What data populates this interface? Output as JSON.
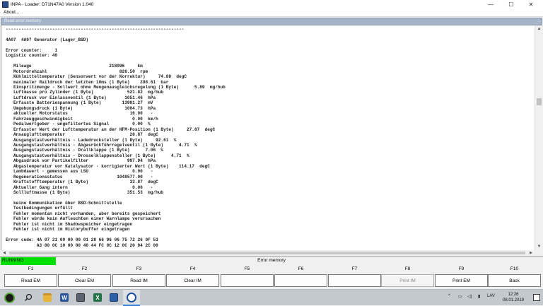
{
  "window": {
    "title": "INPA - Loader:  D71N47A0 Version 1.040",
    "min_glyph": "—",
    "max_glyph": "☐",
    "close_glyph": "✕"
  },
  "menubar": {
    "about": "About..."
  },
  "panel": {
    "header": "Read error memory",
    "text_lines": [
      "---------------------------------------------------------------------",
      "",
      "4A07  4A07 Generator (Lager_BSD)",
      "",
      "Error counter:     1",
      "Logistic counter: 40",
      "",
      "   Mileage                              218096     km",
      "   Motordrehzahl                            826.50  rpm",
      "   Kühlmitteltemperatur (Sensorwert vor der Korrektur)     74.88  degC",
      "   maximaler Raildruck der letzten 10ms (1 Byte)    298.61  bar",
      "   Einspritzmenge - Sollwert ohne Mengenausgleichsregelung (1 Byte)      5.89  mg/hub",
      "   Luftmasse pro Zylinder (1 Byte)             521.82  mg/hub",
      "   Luftdruck vor Einlassventil (1 Byte)       1051.46  hPa",
      "   Erfasste Batteriespannung (1 Byte)        13901.27  mV",
      "   Umgebungsdruck (1 Byte)                    1004.73  hPa",
      "   aktueller Motorstatus                        16.00   -",
      "   Fahrzeuggeschwindigkeit                       0.00  km/h",
      "   Pedalwertgeber - ungefiltertes Signal         0.00  %",
      "   Erfasster Wert der Lufttemperatur an der HFM-Position (1 Byte)     27.87  degC",
      "   Ansauglufttemperatur                         28.87  degC",
      "   Ausgangstastverhältnis - Ladedrucksteller (1 Byte)     92.61  %",
      "   Ausgangstastverhältnis - Abgasrückführregelventil (1 Byte)      4.71  %",
      "   Ausgangstastverhältnis - Drallklappe (1 Byte)      7.06  %",
      "   Ausgangstastverhältnis - Drosselklappensteller (1 Byte)      4.71  %",
      "   Abgasdruck vor Partikelfilter               997.94  hPa",
      "   Abgastemperatur vor Katalysator - korrigierter Wert (1 Byte)    114.17  degC",
      "   Lambdawert - gemessen aus LSU                 0.00   -",
      "   Regenerationsstatus                     1048577.00   -",
      "   Kraftstofftemperatur (1 Byte)                33.87  degC",
      "   Aktueller Gang intern                         0.00   -",
      "   Sollluftmasse (1 Byte)                      351.53  mg/hub",
      "",
      "   keine Kommunikation über BSD-Schnittstelle",
      "   Testbedingungen erfüllt",
      "   Fehler momentan nicht vorhanden, aber bereits gespeichert",
      "   Fehler würde kein Aufleuchten einer Warnlampe verursachen",
      "   Fehler ist nicht im Shadowspeicher eingetragen",
      "   Fehler ist nicht im Historybuffer eingetragen",
      "",
      "Error code: 4A 07 21 00 00 00 01 28 66 96 06 75 72 26 0F 53",
      "            A3 80 0C 10 00 00 40 44 FC 0C 12 0C 20 94 2C 00"
    ]
  },
  "status": {
    "state": "RUNNING",
    "center": "Error memory"
  },
  "fkeys": [
    {
      "key": "F1",
      "label": "Read EM",
      "enabled": true
    },
    {
      "key": "F2",
      "label": "Clear EM",
      "enabled": true
    },
    {
      "key": "F3",
      "label": "Read IM",
      "enabled": true
    },
    {
      "key": "F4",
      "label": "Clear IM",
      "enabled": true
    },
    {
      "key": "F5",
      "label": "",
      "enabled": true
    },
    {
      "key": "F6",
      "label": "",
      "enabled": true
    },
    {
      "key": "F7",
      "label": "",
      "enabled": true
    },
    {
      "key": "F8",
      "label": "Print IM",
      "enabled": false
    },
    {
      "key": "F9",
      "label": "Print EM",
      "enabled": true
    },
    {
      "key": "F10",
      "label": "Back",
      "enabled": true
    }
  ],
  "taskbar": {
    "language": "LAV",
    "time": "12:26",
    "date": "08.01.2019"
  },
  "colors": {
    "running": "#00e000",
    "panel_header": "#a6b4c8",
    "taskbar": "#c3c9cf"
  }
}
